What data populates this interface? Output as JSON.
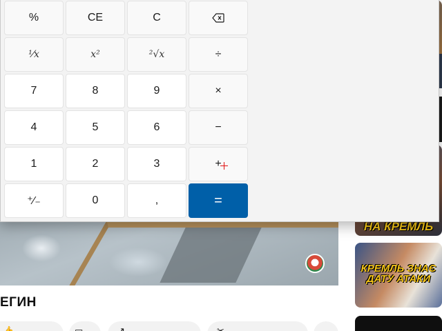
{
  "background_page": {
    "video_title": "ЕГИН",
    "channel_logo": "channel-logo-badge",
    "sidebar_thumbnails": [
      {
        "caption": "НА КРЕМЛЬ"
      },
      {
        "caption": "КРЕМЛЬ ЗНАЄ ДАТУ АТАКИ"
      }
    ],
    "action_chips": [
      {
        "icon": "like-icon"
      },
      {
        "icon": "save-icon"
      },
      {
        "icon": "share-icon"
      },
      {
        "icon": "clip-icon"
      },
      {
        "icon": "more-icon"
      }
    ]
  },
  "calculator": {
    "keys": {
      "percent": "%",
      "clear_entry": "CE",
      "clear": "C",
      "backspace": "backspace-icon",
      "reciprocal": "¹⁄x",
      "square": "x²",
      "sqrt": "²√x",
      "divide": "÷",
      "seven": "7",
      "eight": "8",
      "nine": "9",
      "multiply": "×",
      "four": "4",
      "five": "5",
      "six": "6",
      "minus": "−",
      "one": "1",
      "two": "2",
      "three": "3",
      "plus": "+",
      "negate": "⁺⁄₋",
      "zero": "0",
      "decimal": ",",
      "equals": "="
    },
    "accent_color": "#005fa8"
  }
}
